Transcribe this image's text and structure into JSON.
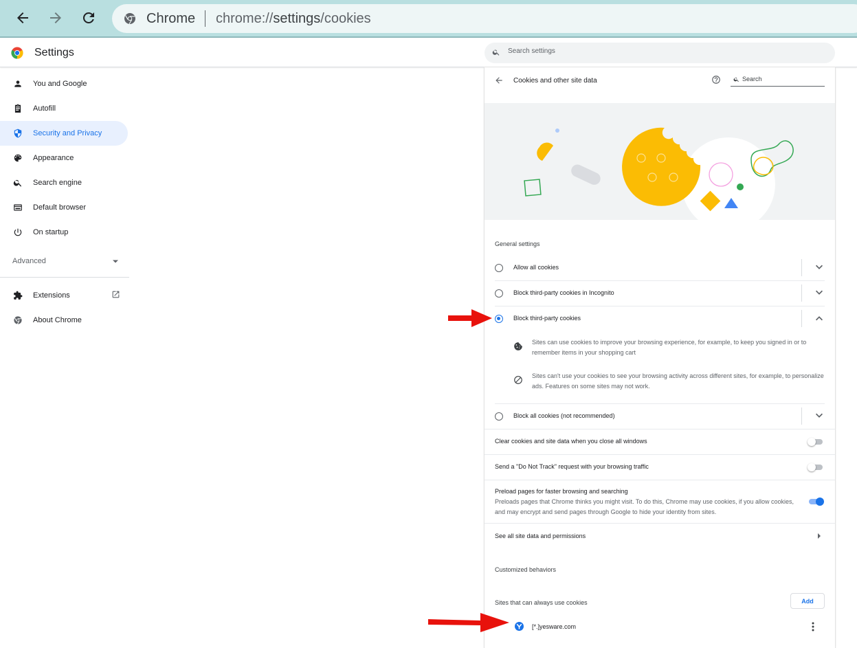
{
  "browser": {
    "chip_label": "Chrome",
    "url_prefix": "chrome://",
    "url_host": "settings",
    "url_path": "/cookies"
  },
  "header": {
    "title": "Settings",
    "search_placeholder": "Search settings"
  },
  "sidebar": {
    "items": [
      {
        "label": "You and Google",
        "icon": "person-icon"
      },
      {
        "label": "Autofill",
        "icon": "clipboard-icon"
      },
      {
        "label": "Security and Privacy",
        "icon": "shield-icon",
        "active": true
      },
      {
        "label": "Appearance",
        "icon": "palette-icon"
      },
      {
        "label": "Search engine",
        "icon": "search-icon"
      },
      {
        "label": "Default browser",
        "icon": "browser-window-icon"
      },
      {
        "label": "On startup",
        "icon": "power-icon"
      }
    ],
    "advanced_label": "Advanced",
    "extensions_label": "Extensions",
    "about_label": "About Chrome"
  },
  "page": {
    "title": "Cookies and other site data",
    "search_placeholder": "Search",
    "general_settings_label": "General settings",
    "options": [
      {
        "label": "Allow all cookies",
        "selected": false
      },
      {
        "label": "Block third-party cookies in Incognito",
        "selected": false
      },
      {
        "label": "Block third-party cookies",
        "selected": true
      },
      {
        "label": "Block all cookies (not recommended)",
        "selected": false
      }
    ],
    "details": [
      {
        "icon": "cookie-icon",
        "text": "Sites can use cookies to improve your browsing experience, for example, to keep you signed in or to remember items in your shopping cart"
      },
      {
        "icon": "block-icon",
        "text": "Sites can't use your cookies to see your browsing activity across different sites, for example, to personalize ads. Features on some sites may not work."
      }
    ],
    "toggles": {
      "clear_on_exit": {
        "label": "Clear cookies and site data when you close all windows",
        "on": false
      },
      "do_not_track": {
        "label": "Send a \"Do Not Track\" request with your browsing traffic",
        "on": false
      },
      "preload": {
        "title": "Preload pages for faster browsing and searching",
        "description": "Preloads pages that Chrome thinks you might visit. To do this, Chrome may use cookies, if you allow cookies, and may encrypt and send pages through Google to hide your identity from sites.",
        "on": true
      }
    },
    "see_all_label": "See all site data and permissions",
    "customized_label": "Customized behaviors",
    "always_allow_label": "Sites that can always use cookies",
    "add_label": "Add",
    "sites": [
      {
        "name": "[*.]yesware.com"
      }
    ]
  },
  "colors": {
    "accent": "#1a73e8",
    "active_bg": "#e8f0fe",
    "browser_frame": "#b9dfe0",
    "annotation_arrow": "#e8120c",
    "cookie_yellow": "#fbbc04"
  }
}
